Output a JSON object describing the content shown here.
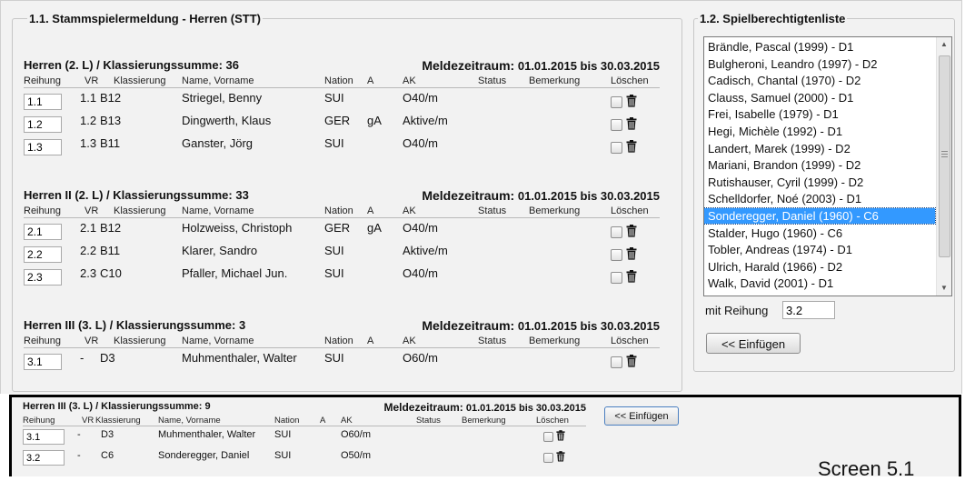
{
  "left_panel": {
    "legend": "1.1. Stammspielermeldung - Herren (STT)",
    "period_label": "Meldezeitraum:",
    "period_value": "01.01.2015 bis 30.03.2015",
    "columns": [
      "Reihung",
      "VR",
      "Klassierung",
      "Name, Vorname",
      "Nation",
      "A",
      "AK",
      "Status",
      "Bemerkung",
      "Löschen"
    ],
    "teams": [
      {
        "title": "Herren (2. L) / Klassierungssumme: 36",
        "rows": [
          {
            "reihung": "1.1",
            "vr": "1.1",
            "klass": "B12",
            "name": "Striegel, Benny",
            "nation": "SUI",
            "a": "",
            "ak": "O40/m"
          },
          {
            "reihung": "1.2",
            "vr": "1.2",
            "klass": "B13",
            "name": "Dingwerth, Klaus",
            "nation": "GER",
            "a": "gA",
            "ak": "Aktive/m"
          },
          {
            "reihung": "1.3",
            "vr": "1.3",
            "klass": "B11",
            "name": "Ganster, Jörg",
            "nation": "SUI",
            "a": "",
            "ak": "O40/m"
          }
        ]
      },
      {
        "title": "Herren II (2. L) / Klassierungssumme: 33",
        "rows": [
          {
            "reihung": "2.1",
            "vr": "2.1",
            "klass": "B12",
            "name": "Holzweiss, Christoph",
            "nation": "GER",
            "a": "gA",
            "ak": "O40/m"
          },
          {
            "reihung": "2.2",
            "vr": "2.2",
            "klass": "B11",
            "name": "Klarer, Sandro",
            "nation": "SUI",
            "a": "",
            "ak": "Aktive/m"
          },
          {
            "reihung": "2.3",
            "vr": "2.3",
            "klass": "C10",
            "name": "Pfaller, Michael Jun.",
            "nation": "SUI",
            "a": "",
            "ak": "O40/m"
          }
        ]
      },
      {
        "title": "Herren III (3. L) / Klassierungssumme: 3",
        "rows": [
          {
            "reihung": "3.1",
            "vr": "-",
            "klass": "D3",
            "name": "Muhmenthaler, Walter",
            "nation": "SUI",
            "a": "",
            "ak": "O60/m"
          }
        ]
      }
    ]
  },
  "right_panel": {
    "legend": "1.2. Spielberechtigtenliste",
    "list_items": [
      "Brändle, Pascal (1999) - D1",
      "Bulgheroni, Leandro (1997) - D2",
      "Cadisch, Chantal (1970) - D2",
      "Clauss, Samuel (2000) - D1",
      "Frei, Isabelle (1979) - D1",
      "Hegi, Michèle (1992) - D1",
      "Landert, Marek (1999) - D2",
      "Mariani, Brandon (1999) - D2",
      "Rutishauser, Cyril (1999) - D2",
      "Schelldorfer, Noé (2003) - D1",
      "Sonderegger, Daniel (1960) - C6",
      "Stalder, Hugo (1960) - C6",
      "Tobler, Andreas (1974) - D1",
      "Ulrich, Harald (1966) - D2",
      "Walk, David (2001) - D1"
    ],
    "selected_item": "Sonderegger, Daniel (1960) - C6",
    "mit_reihung_label": "mit Reihung",
    "mit_reihung_value": "3.2",
    "insert_button": "<< Einfügen"
  },
  "bottom_overlay": {
    "title": "Herren III (3. L) / Klassierungssumme: 9",
    "period_label": "Meldezeitraum:",
    "period_value": "01.01.2015 bis 30.03.2015",
    "columns": [
      "Reihung",
      "VR",
      "Klassierung",
      "Name, Vorname",
      "Nation",
      "A",
      "AK",
      "Status",
      "Bemerkung",
      "Löschen"
    ],
    "rows": [
      {
        "reihung": "3.1",
        "vr": "-",
        "klass": "D3",
        "name": "Muhmenthaler, Walter",
        "nation": "SUI",
        "a": "",
        "ak": "O60/m"
      },
      {
        "reihung": "3.2",
        "vr": "-",
        "klass": "C6",
        "name": "Sonderegger, Daniel",
        "nation": "SUI",
        "a": "",
        "ak": "O50/m"
      }
    ],
    "insert_button": "<< Einfügen",
    "screen_label": "Screen 5.1"
  },
  "icons": {
    "delete": "trash-icon",
    "checkbox": "checkbox-icon",
    "scroll_up": "scroll-up-arrow-icon",
    "scroll_down": "scroll-down-arrow-icon"
  },
  "colors": {
    "selection": "#3399ff",
    "panel_bg": "#f2f2f2",
    "overlay_border": "#000000"
  }
}
